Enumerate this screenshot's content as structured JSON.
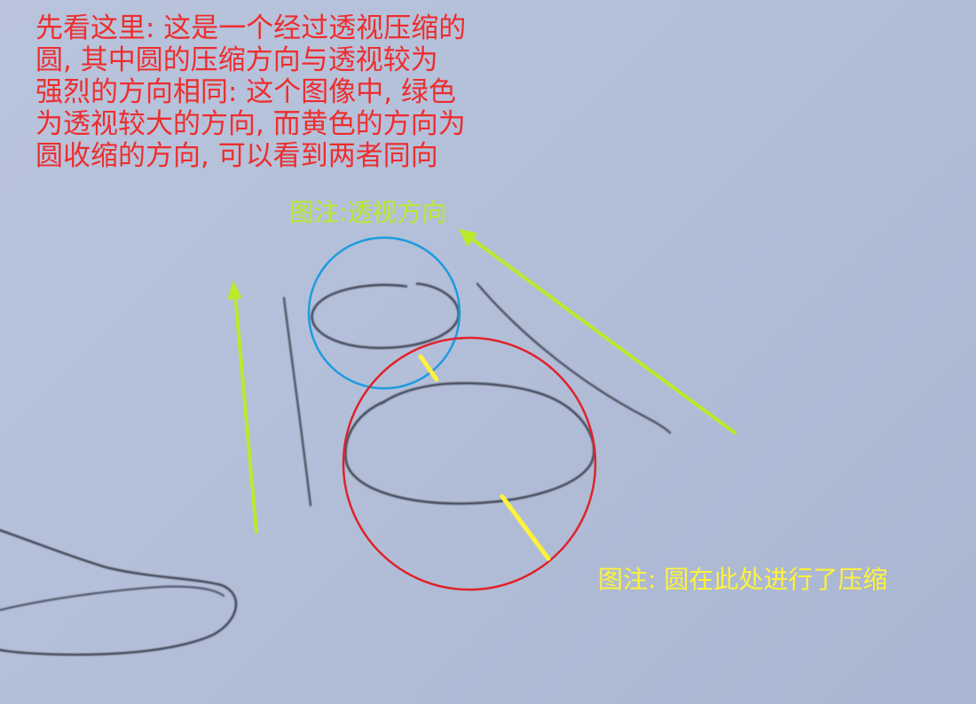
{
  "intro_text": {
    "lines": [
      "先看这里: 这是一个经过透视压缩的",
      "圆, 其中圆的压缩方向与透视较为",
      "强烈的方向相同: 这个图像中, 绿色",
      "为透视较大的方向, 而黄色的方向为",
      "圆收缩的方向, 可以看到两者同向"
    ],
    "color": "#ee2d2d"
  },
  "annotations": {
    "perspective_label": "图注:透视方向",
    "perspective_color": "#b9ea2c",
    "compression_label": "图注: 圆在此处进行了压缩",
    "compression_color": "#fff23a"
  },
  "highlight_colors": {
    "small_circle": "#1e9be0",
    "large_circle": "#e0222a",
    "pencil": "#2f3340"
  }
}
